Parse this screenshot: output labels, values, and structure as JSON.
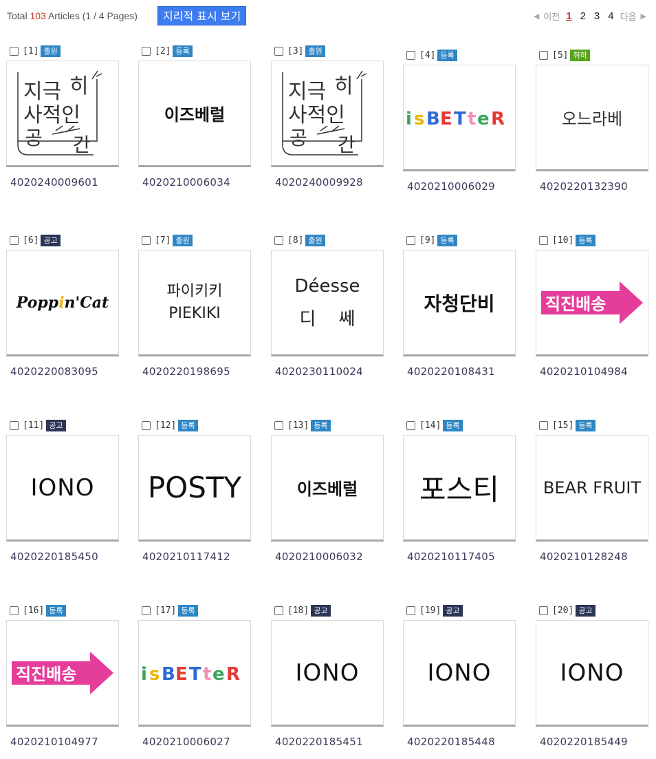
{
  "header": {
    "total_prefix": "Total ",
    "total_count": "103",
    "total_suffix": " Articles (1 / 4 Pages)",
    "geo_button": "지리적 표시 보기"
  },
  "pager": {
    "prev": "이전",
    "pages": [
      "1",
      "2",
      "3",
      "4"
    ],
    "current": "1",
    "next": "다음"
  },
  "items": [
    {
      "idx": "[1]",
      "status": "출원",
      "code": "4020240009601",
      "logo": "지극히사적인공간"
    },
    {
      "idx": "[2]",
      "status": "등록",
      "code": "4020210006034",
      "logo": "이즈베럴"
    },
    {
      "idx": "[3]",
      "status": "출원",
      "code": "4020240009928",
      "logo": "지극히사적인공간"
    },
    {
      "idx": "[4]",
      "status": "등록",
      "code": "4020210006029",
      "logo": "isBETteR"
    },
    {
      "idx": "[5]",
      "status": "취하",
      "code": "4020220132390",
      "logo": "오느라베"
    },
    {
      "idx": "[6]",
      "status": "공고",
      "code": "4020220083095",
      "logo": "Poppin'Cat"
    },
    {
      "idx": "[7]",
      "status": "출원",
      "code": "4020220198695",
      "logo": "파이키키 PIEKIKI"
    },
    {
      "idx": "[8]",
      "status": "출원",
      "code": "4020230110024",
      "logo": "Déesse 디 쎄"
    },
    {
      "idx": "[9]",
      "status": "등록",
      "code": "4020220108431",
      "logo": "자청단비"
    },
    {
      "idx": "[10]",
      "status": "등록",
      "code": "4020210104984",
      "logo": "직진배송"
    },
    {
      "idx": "[11]",
      "status": "공고",
      "code": "4020220185450",
      "logo": "IONO"
    },
    {
      "idx": "[12]",
      "status": "등록",
      "code": "4020210117412",
      "logo": "POSTY"
    },
    {
      "idx": "[13]",
      "status": "등록",
      "code": "4020210006032",
      "logo": "이즈베럴"
    },
    {
      "idx": "[14]",
      "status": "등록",
      "code": "4020210117405",
      "logo": "포스티"
    },
    {
      "idx": "[15]",
      "status": "등록",
      "code": "4020210128248",
      "logo": "BEAR FRUIT"
    },
    {
      "idx": "[16]",
      "status": "등록",
      "code": "4020210104977",
      "logo": "직진배송"
    },
    {
      "idx": "[17]",
      "status": "등록",
      "code": "4020210006027",
      "logo": "isBETteR"
    },
    {
      "idx": "[18]",
      "status": "공고",
      "code": "4020220185451",
      "logo": "IONO"
    },
    {
      "idx": "[19]",
      "status": "공고",
      "code": "4020220185448",
      "logo": "IONO"
    },
    {
      "idx": "[20]",
      "status": "공고",
      "code": "4020220185449",
      "logo": "IONO"
    }
  ],
  "colors": {
    "badge_출원": "#2f86c5",
    "badge_등록": "#2f86c5",
    "badge_공고": "#2b3556",
    "badge_취하": "#58a51c",
    "geo_button": "#3d7cf0",
    "current_page": "#c0392b"
  }
}
